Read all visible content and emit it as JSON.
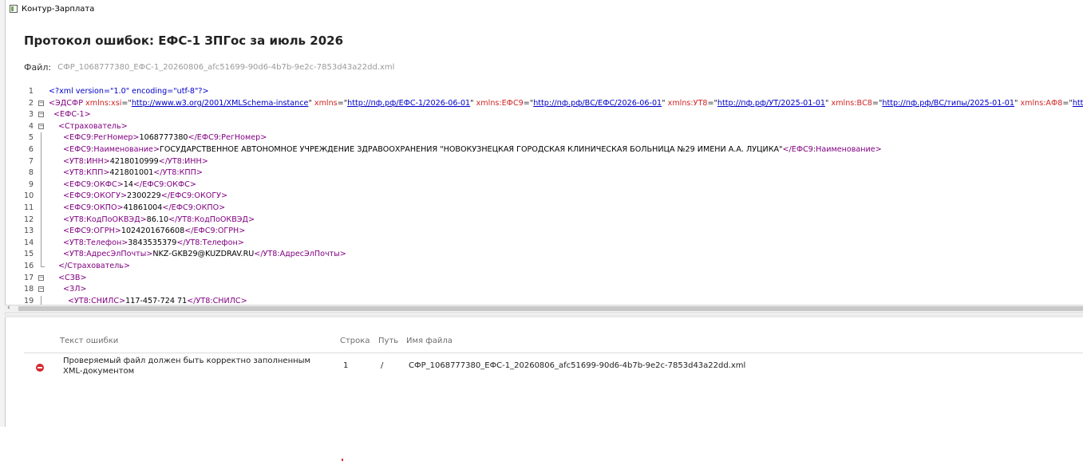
{
  "window": {
    "title": "Контур-Зарплата"
  },
  "page": {
    "title": "Протокол ошибок: ЕФС-1 ЗПГос за июль 2026",
    "file_label": "Файл:",
    "file_value": "СФР_1068777380_ЕФС-1_20260806_afc51699-90d6-4b7b-9e2c-7853d43a22dd.xml"
  },
  "editor": {
    "line_numbers": [
      "1",
      "2",
      "3",
      "4",
      "5",
      "6",
      "7",
      "8",
      "9",
      "10",
      "11",
      "12",
      "13",
      "14",
      "15",
      "16",
      "17",
      "18",
      "19"
    ],
    "line1": "<?xml version=\"1.0\" encoding=\"utf-8\"?>",
    "line2": {
      "open": "<ЭДСФР",
      "attr1": "xmlns:xsi",
      "url1": "http://www.w3.org/2001/XMLSchema-instance",
      "attr2": "xmlns",
      "url2": "http://пф.рф/ЕФС-1/2026-06-01",
      "attr3": "xmlns:ЕФС9",
      "url3": "http://пф.рф/ВС/ЕФС/2026-06-01",
      "attr4": "xmlns:УТ8",
      "url4": "http://пф.рф/УТ/2025-01-01",
      "attr5": "xmlns:ВС8",
      "url5": "http://пф.рф/ВС/типы/2025-01-01",
      "attr6": "xmlns:АФ8",
      "url6": "http:"
    },
    "line3": "<ЕФС-1>",
    "line4": "<Страхователь>",
    "line5": {
      "open": "<ЕФС9:РегНомер>",
      "value": "1068777380",
      "close": "</ЕФС9:РегНомер>"
    },
    "line6": {
      "open": "<ЕФС9:Наименование>",
      "value": "ГОСУДАРСТВЕННОЕ АВТОНОМНОЕ УЧРЕЖДЕНИЕ ЗДРАВООХРАНЕНИЯ \"НОВОКУЗНЕЦКАЯ ГОРОДСКАЯ КЛИНИЧЕСКАЯ БОЛЬНИЦА №29 ИМЕНИ А.А. ЛУЦИКА\"",
      "close": "</ЕФС9:Наименование>"
    },
    "line7": {
      "open": "<УТ8:ИНН>",
      "value": "4218010999",
      "close": "</УТ8:ИНН>"
    },
    "line8": {
      "open": "<УТ8:КПП>",
      "value": "421801001",
      "close": "</УТ8:КПП>"
    },
    "line9": {
      "open": "<ЕФС9:ОКФС>",
      "value": "14",
      "close": "</ЕФС9:ОКФС>"
    },
    "line10": {
      "open": "<ЕФС9:ОКОГУ>",
      "value": "2300229",
      "close": "</ЕФС9:ОКОГУ>"
    },
    "line11": {
      "open": "<ЕФС9:ОКПО>",
      "value": "41861004",
      "close": "</ЕФС9:ОКПО>"
    },
    "line12": {
      "open": "<УТ8:КодПоОКВЭД>",
      "value": "86.10",
      "close": "</УТ8:КодПоОКВЭД>"
    },
    "line13": {
      "open": "<ЕФС9:ОГРН>",
      "value": "1024201676608",
      "close": "</ЕФС9:ОГРН>"
    },
    "line14": {
      "open": "<УТ8:Телефон>",
      "value": "3843535379",
      "close": "</УТ8:Телефон>"
    },
    "line15": {
      "open": "<УТ8:АдресЭлПочты>",
      "value": "NKZ-GKB29@KUZDRAV.RU",
      "close": "</УТ8:АдресЭлПочты>"
    },
    "line16": "</Страхователь>",
    "line17": "<СЗВ>",
    "line18": "<ЗЛ>",
    "line19": {
      "open": "<УТ8:СНИЛС>",
      "value": "117-457-724 71",
      "close": "</УТ8:СНИЛС>"
    }
  },
  "errors": {
    "headers": {
      "text": "Текст ошибки",
      "line": "Строка",
      "path": "Путь",
      "file": "Имя файла"
    },
    "rows": [
      {
        "icon": "error-icon",
        "text": "Проверяемый файл должен быть корректно заполненным XML-документом",
        "line": "1",
        "path": "/",
        "file": "СФР_1068777380_ЕФС-1_20260806_afc51699-90d6-4b7b-9e2c-7853d43a22dd.xml"
      }
    ]
  },
  "colors": {
    "error": "#d7262e",
    "tag": "#800080",
    "attr": "#d12323",
    "link": "#0000c8"
  }
}
